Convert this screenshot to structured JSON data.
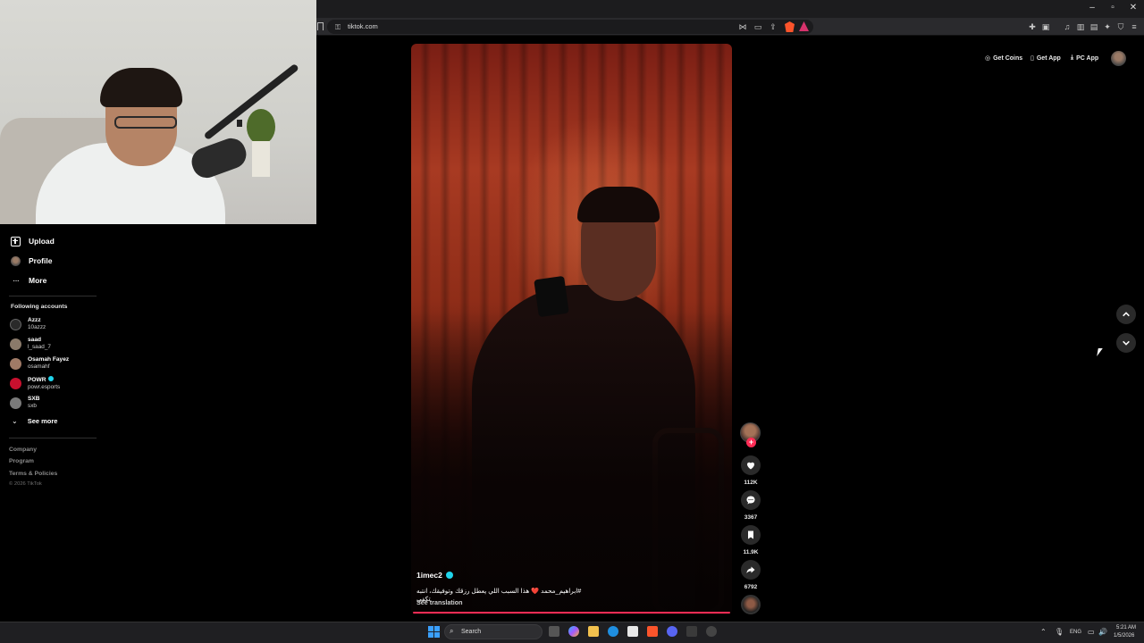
{
  "browser": {
    "url": "tiktok.com",
    "window_controls": [
      "–",
      "▫",
      "✕"
    ]
  },
  "sidebar": {
    "nav": [
      {
        "label": "Upload",
        "icon": "upload-icon"
      },
      {
        "label": "Profile",
        "icon": "profile-avatar"
      },
      {
        "label": "More",
        "icon": "more-icon"
      }
    ],
    "following_title": "Following accounts",
    "accounts": [
      {
        "name": "Azzz",
        "handle": "10azzz",
        "verified": false,
        "color": "#6b6b6b"
      },
      {
        "name": "saad",
        "handle": "l_saad_7",
        "verified": false,
        "color": "#8a7a6a"
      },
      {
        "name": "Osamah Fayez",
        "handle": "osamahf",
        "verified": false,
        "color": "#a07a66"
      },
      {
        "name": "POWR",
        "handle": "powr.esports",
        "verified": true,
        "color": "#c8102e"
      },
      {
        "name": "SXB",
        "handle": "sxb",
        "verified": false,
        "color": "#7a7a7a"
      }
    ],
    "see_more": "See more",
    "footer": [
      "Company",
      "Program",
      "Terms & Policies"
    ],
    "copyright": "© 2026 TikTok"
  },
  "header": {
    "get_coins": "Get Coins",
    "get_app": "Get App",
    "pc_app": "PC App"
  },
  "video": {
    "username": "1imec2",
    "verified": true,
    "caption": "#ابراهيم_محمد ❤️ هذا السبب اللي يعطل رزقك وتوفيقك، انتبه تكفى",
    "see_translation": "See translation",
    "progress": 1.0
  },
  "actions": {
    "likes": "112K",
    "comments": "3367",
    "saves": "11.9K",
    "shares": "6792"
  },
  "taskbar": {
    "search_label": "Search",
    "lang": "ENG",
    "time": "5:21 AM",
    "date": "1/5/2026"
  },
  "colors": {
    "accent": "#fe2c55",
    "verified": "#20d5ec",
    "background": "#000000"
  }
}
